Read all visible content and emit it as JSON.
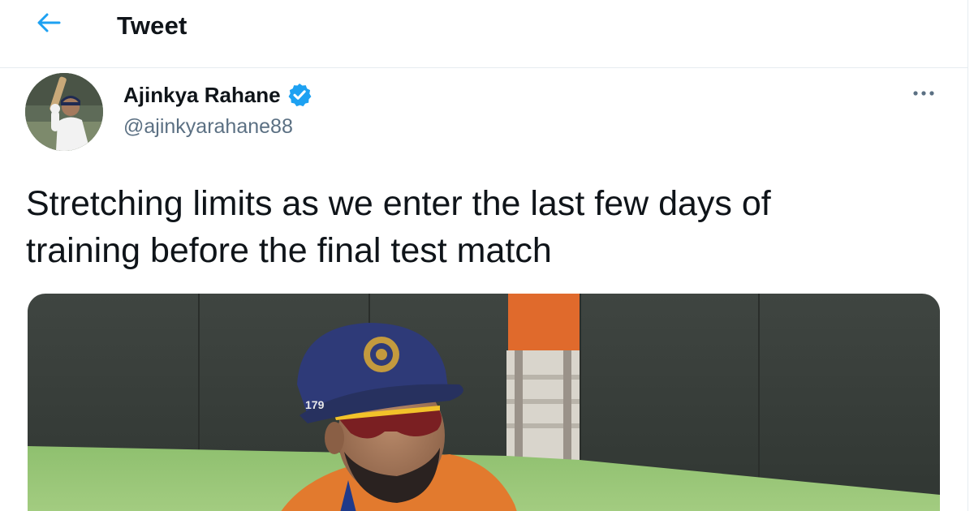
{
  "header": {
    "title": "Tweet",
    "back_icon": "arrow-left-icon",
    "accent_color": "#1da1f2"
  },
  "tweet": {
    "author": {
      "display_name": "Ajinkya Rahane",
      "handle": "@ajinkyarahane88",
      "verified": true,
      "verified_color": "#1da1f2"
    },
    "text_line_1": "Stretching limits as we enter the last few days of",
    "text_line_2": "training before the final test match",
    "more_icon": "more-horizontal-icon",
    "media_alt": "Player in blue cap and orange training jersey on the field"
  }
}
